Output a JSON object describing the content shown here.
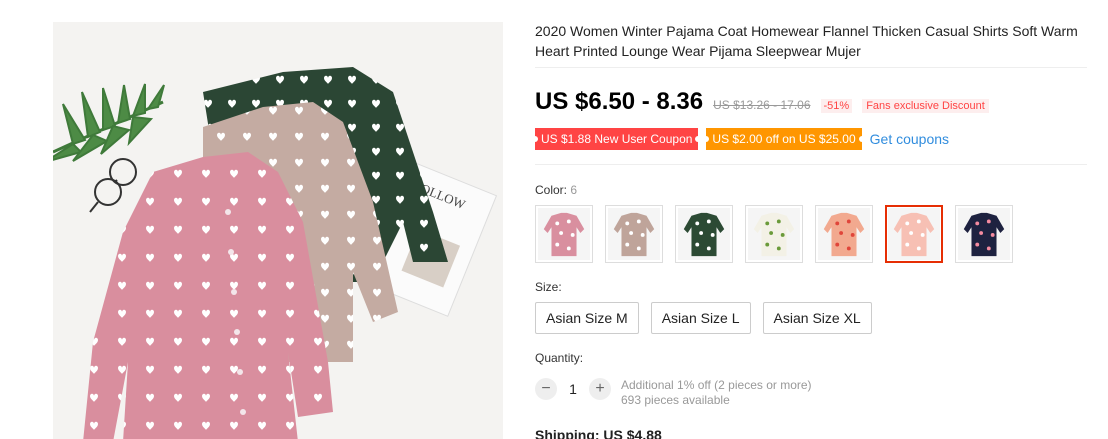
{
  "product": {
    "title": "2020 Women Winter Pajama Coat Homewear Flannel Thicken Casual Shirts Soft Warm Heart Printed Lounge Wear Pijama Sleepwear Mujer",
    "price": "US $6.50 - 8.36",
    "original_price": "US $13.26 - 17.06",
    "discount": "-51%",
    "fans_discount": "Fans exclusive Discount",
    "photo_text": "FOLLOW"
  },
  "coupons": {
    "new_user": "US $1.88 New User Coupon",
    "store": "US $2.00 off on US $25.00",
    "get_coupons": "Get coupons"
  },
  "color": {
    "label": "Color:",
    "selected": "6",
    "swatches": [
      {
        "name": "pink-heart",
        "bg": "#d98f9f",
        "dot": "#ffffff"
      },
      {
        "name": "beige-heart",
        "bg": "#bfa49a",
        "dot": "#ffffff"
      },
      {
        "name": "green-heart",
        "bg": "#2c4a34",
        "dot": "#ffffff"
      },
      {
        "name": "white-cactus",
        "bg": "#f3f1e6",
        "dot": "#6a9a3a"
      },
      {
        "name": "pink-fruit",
        "bg": "#f2a98f",
        "dot": "#e0453a"
      },
      {
        "name": "pink-flamingo",
        "bg": "#f7c0b4",
        "dot": "#ffffff"
      },
      {
        "name": "navy-flamingo",
        "bg": "#1e2240",
        "dot": "#f58ba0"
      }
    ],
    "selected_index": 5
  },
  "size": {
    "label": "Size:",
    "options": [
      "Asian Size M",
      "Asian Size L",
      "Asian Size XL"
    ]
  },
  "quantity": {
    "label": "Quantity:",
    "value": "1",
    "minus": "−",
    "plus": "+",
    "bulk_info": "Additional 1% off (2 pieces or more)",
    "available": "693 pieces available"
  },
  "shipping": {
    "text": "Shipping: US $4.88"
  },
  "colors": {
    "accent_red": "#ff4444",
    "coupon_orange": "#ff9600",
    "link_blue": "#318dde",
    "selected_border": "#e62e04"
  }
}
